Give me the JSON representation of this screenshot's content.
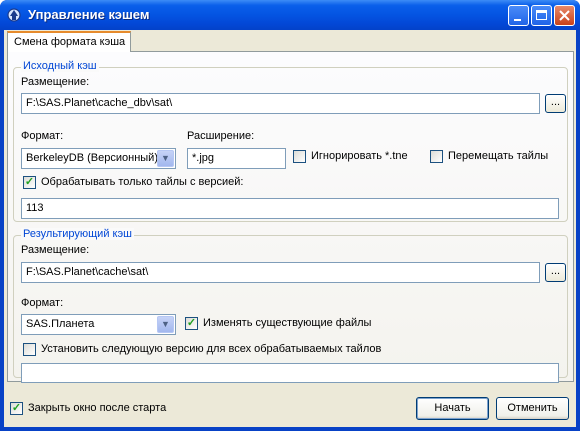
{
  "window": {
    "title": "Управление кэшем"
  },
  "tab": {
    "label": "Смена формата кэша"
  },
  "source": {
    "group_title": "Исходный кэш",
    "location_label": "Размещение:",
    "location_value": "F:\\SAS.Planet\\cache_dbv\\sat\\",
    "browse_label": "...",
    "format_label": "Формат:",
    "format_value": "BerkeleyDB (Версионный)",
    "extension_label": "Расширение:",
    "extension_value": "*.jpg",
    "ignore_label": "Игнорировать *.tne",
    "ignore_checked": false,
    "move_label": "Перемещать тайлы",
    "move_checked": false,
    "version_only_label": "Обрабатывать только тайлы с версией:",
    "version_only_checked": true,
    "version_value": "113"
  },
  "target": {
    "group_title": "Результирующий кэш",
    "location_label": "Размещение:",
    "location_value": "F:\\SAS.Planet\\cache\\sat\\",
    "browse_label": "...",
    "format_label": "Формат:",
    "format_value": "SAS.Планета",
    "overwrite_label": "Изменять существующие файлы",
    "overwrite_checked": true,
    "set_version_label": "Установить следующую версию для всех обрабатываемых тайлов",
    "set_version_checked": false,
    "set_version_value": ""
  },
  "footer": {
    "close_after_start_label": "Закрыть окно после старта",
    "close_after_start_checked": true,
    "start_label": "Начать",
    "cancel_label": "Отменить"
  }
}
